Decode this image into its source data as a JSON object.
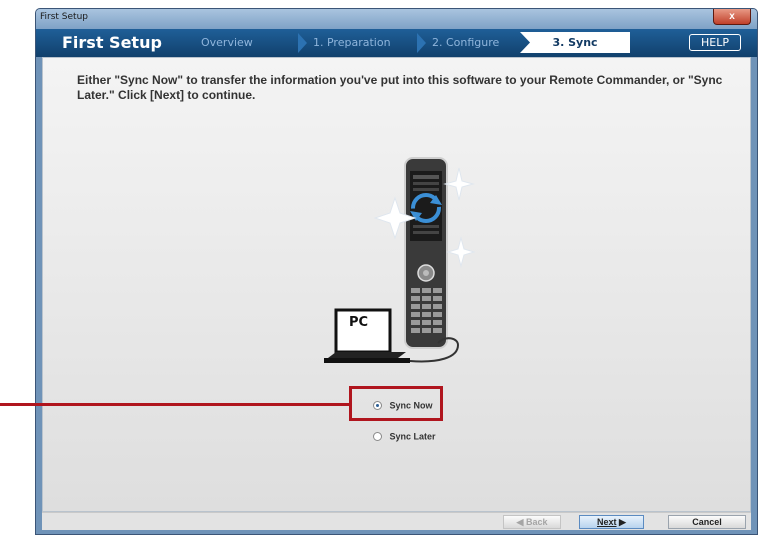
{
  "window": {
    "title": "First Setup",
    "close_label": "x"
  },
  "header": {
    "app_title": "First Setup",
    "steps": [
      "Overview",
      "1. Preparation",
      "2. Configure"
    ],
    "active_step": "3. Sync",
    "help_label": "HELP"
  },
  "content": {
    "instruction": "Either \"Sync Now\" to transfer the information you've put into this software to your Remote Commander, or \"Sync Later.\" Click [Next] to continue.",
    "pc_label": "PC",
    "options": [
      {
        "label": "Sync Now",
        "selected": true
      },
      {
        "label": "Sync Later",
        "selected": false
      }
    ]
  },
  "footer": {
    "back_label": "Back",
    "next_label": "Next",
    "cancel_label": "Cancel"
  },
  "colors": {
    "header_bg": "#154f82",
    "callout": "#b0151e",
    "accent": "#2c72b2"
  }
}
